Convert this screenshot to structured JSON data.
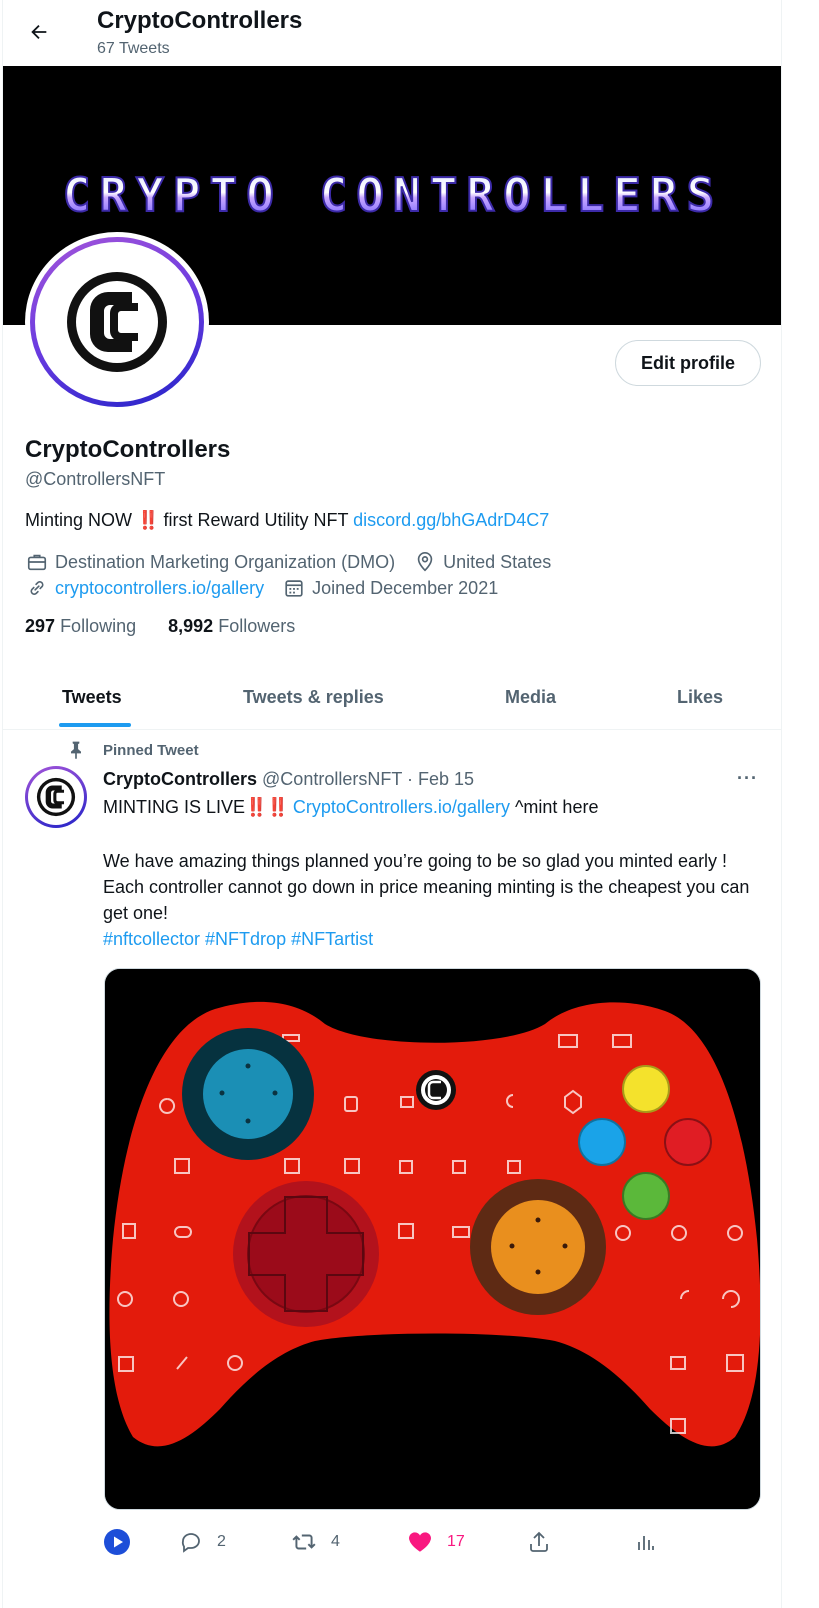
{
  "header": {
    "title": "CryptoControllers",
    "tweet_count": "67 Tweets"
  },
  "banner": {
    "text": "CRYPTO CONTROLLERS"
  },
  "profile": {
    "edit_label": "Edit profile",
    "name": "CryptoControllers",
    "handle": "@ControllersNFT",
    "bio_prefix": "Minting NOW",
    "bio_bangs": "‼️",
    "bio_middle": "first Reward Utility NFT",
    "bio_link": "discord.gg/bhGAdrD4C7",
    "category": "Destination Marketing Organization (DMO)",
    "location": "United States",
    "website": "cryptocontrollers.io/gallery",
    "joined": "Joined December 2021",
    "following_count": "297",
    "following_label": "Following",
    "followers_count": "8,992",
    "followers_label": "Followers"
  },
  "tabs": [
    {
      "label": "Tweets",
      "active": true
    },
    {
      "label": "Tweets & replies",
      "active": false
    },
    {
      "label": "Media",
      "active": false
    },
    {
      "label": "Likes",
      "active": false
    }
  ],
  "tweet": {
    "pinned_label": "Pinned Tweet",
    "author_name": "CryptoControllers",
    "author_handle": "@ControllersNFT",
    "separator": "·",
    "date": "Feb 15",
    "more": "···",
    "line1_text": "MINTING IS LIVE",
    "line1_bangs": "‼️‼️",
    "line1_link": "CryptoControllers.io/gallery",
    "line1_suffix": "^mint here",
    "body": "We have amazing things planned you’re going to be so glad you minted early ! Each controller cannot go down in price meaning minting is the cheapest you can get one!",
    "hashtags": "#nftcollector #NFTdrop #NFTartist",
    "replies": "2",
    "retweets": "4",
    "likes": "17"
  },
  "colors": {
    "accent": "#1d9bf0",
    "like": "#f91880",
    "banner_bg": "#000000",
    "controller_red": "#e31b0c"
  }
}
